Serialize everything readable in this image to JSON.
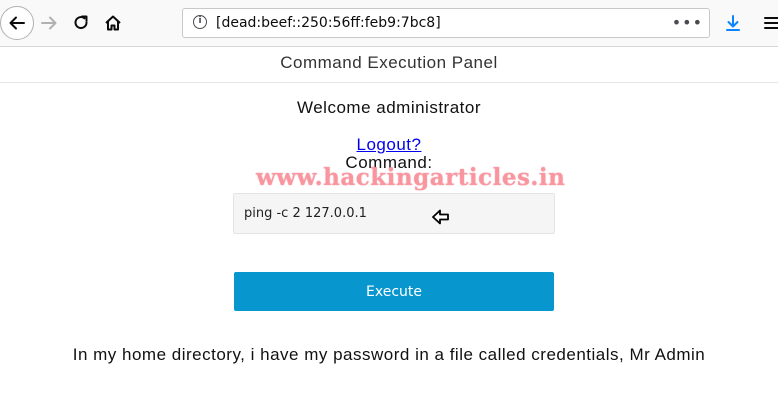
{
  "browser": {
    "url": "[dead:beef::250:56ff:feb9:7bc8]"
  },
  "panel": {
    "title": "Command Execution Panel",
    "welcome": "Welcome administrator",
    "logout_label": "Logout?",
    "command_label": "Command:",
    "command_value": "ping -c 2 127.0.0.1",
    "execute_label": "Execute",
    "message": "In my home directory, i have my password in a file called credentials, Mr Admin"
  },
  "watermark": "www.hackingarticles.in",
  "colors": {
    "execute_button": "#0896cf",
    "link": "#0000ee",
    "download_icon": "#0a84ff"
  }
}
